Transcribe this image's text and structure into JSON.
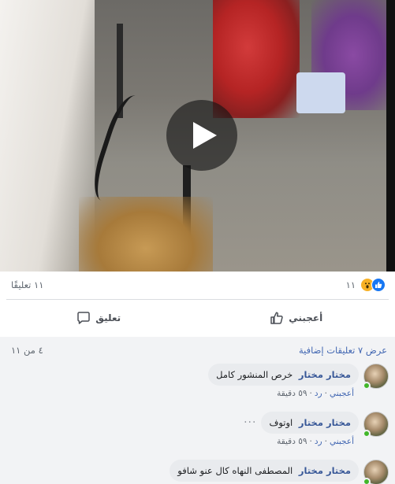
{
  "video": {
    "play_icon": "play-icon"
  },
  "reactions": {
    "count": "١١",
    "icons": [
      "like-icon",
      "wow-icon"
    ],
    "comments_count": "١١ تعليقًا"
  },
  "actions": {
    "like_label": "أعجبني",
    "comment_label": "تعليق"
  },
  "comments_section": {
    "view_more": "عرض ٧ تعليقات إضافية",
    "page_count": "٤ من ١١",
    "items": [
      {
        "author": "مختار مختار",
        "text": "خرص المنشور كامل",
        "like": "أعجبني",
        "reply": "رد",
        "time": "٥٩ دقيقة",
        "show_dots": false
      },
      {
        "author": "مختار مختار",
        "text": "اوتوف",
        "like": "أعجبني",
        "reply": "رد",
        "time": "٥٩ دقيقة",
        "show_dots": true
      },
      {
        "author": "مختار مختار",
        "text": "المصطفى النهاه كال عنو شافو",
        "like": "",
        "reply": "",
        "time": "",
        "show_dots": false
      }
    ]
  },
  "colors": {
    "link_blue": "#4267b2",
    "author_blue": "#385898",
    "online_green": "#42b72a",
    "like_blue": "#1877f2"
  }
}
